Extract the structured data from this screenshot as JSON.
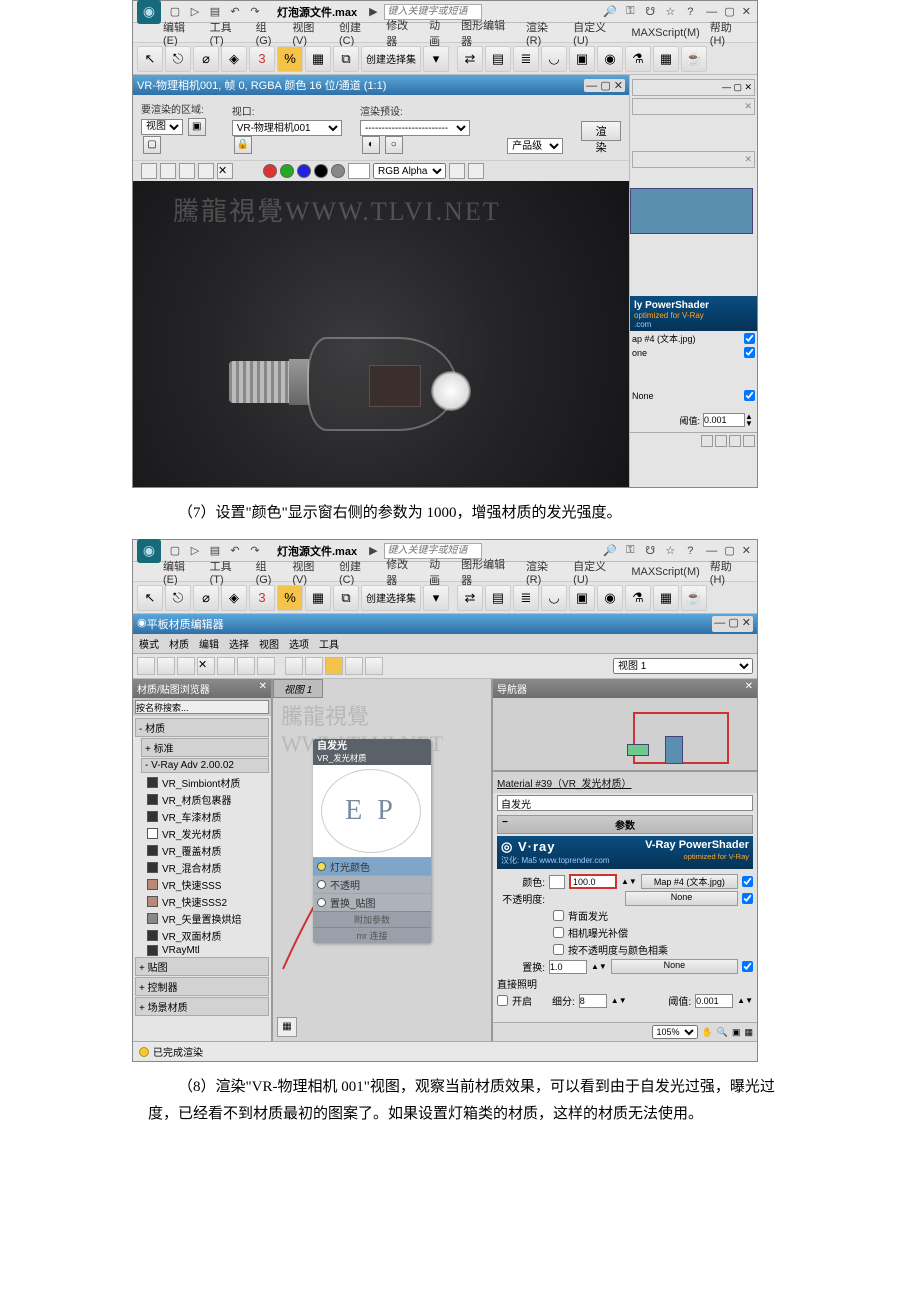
{
  "filename": "灯泡源文件.max",
  "search_placeholder": "键入关键字或短语",
  "menus": [
    "编辑(E)",
    "工具(T)",
    "组(G)",
    "视图(V)",
    "创建(C)",
    "修改器",
    "动画",
    "图形编辑器",
    "渲染(R)",
    "自定义(U)",
    "MAXScript(M)",
    "帮助(H)"
  ],
  "toolbar_label": "创建选择集",
  "frame": {
    "title": "VR-物理相机001, 帧 0, RGBA 颜色 16 位/通道 (1:1)",
    "area_lbl": "要渲染的区域:",
    "area_val": "视图",
    "viewport_lbl": "视口:",
    "viewport_val": "VR-物理相机001",
    "preset_lbl": "渲染预设:",
    "preset_val": "-------------------------",
    "prod_val": "产品级",
    "render_btn": "渲染",
    "channel": "RGB Alpha"
  },
  "watermark": "騰龍視覺WWW.TLVI.NET",
  "right": {
    "ps_title": "ly PowerShader",
    "ps_sub": "optimized for V-Ray",
    "map1": "ap #4 (文本.jpg)",
    "map2": "one",
    "map3": "None",
    "thresh_lbl": "阈值:",
    "thresh_val": "0.001"
  },
  "para7": "（7）设置\"颜色\"显示窗右侧的参数为 1000，增强材质的发光强度。",
  "slate": {
    "title": "平板材质编辑器",
    "menu": [
      "模式",
      "材质",
      "编辑",
      "选择",
      "视图",
      "选项",
      "工具"
    ],
    "viewsel": "视图 1",
    "browser_hdr": "材质/贴图浏览器",
    "search": "按名称搜索...",
    "g_mat": "- 材质",
    "g_std": "+ 标准",
    "g_vray": "- V-Ray Adv 2.00.02",
    "mats": [
      "VR_Simbiont材质",
      "VR_材质包裹器",
      "VR_车漆材质",
      "VR_发光材质",
      "VR_覆盖材质",
      "VR_混合材质",
      "VR_快速SSS",
      "VR_快速SSS2",
      "VR_矢量置换烘焙",
      "VR_双面材质",
      "VRayMtl"
    ],
    "g_map": "+ 贴图",
    "g_ctrl": "+ 控制器",
    "g_scene": "+ 场景材质",
    "nodeview_tab": "视图 1",
    "node_title1": "自发光",
    "node_title2": "VR_发光材质",
    "slot1": "灯光颜色",
    "slot2": "不透明",
    "slot3": "置换_贴图",
    "slot_add": "附加参数",
    "slot_mr": "mr 连接",
    "navi_hdr": "导航器",
    "matname": "Material #39（VR_发光材质）",
    "self_illum": "自发光",
    "roll": "参数",
    "vray_logo": "V·ray",
    "ps_big": "V-Ray PowerShader",
    "ps_small": "optimized for V-Ray",
    "hanhua": "汉化: Ma5 www.toprender.com",
    "color_lbl": "颜色:",
    "color_val": "100.0",
    "color_map": "Map #4 (文本.jpg)",
    "opacity_lbl": "不透明度:",
    "opacity_map": "None",
    "cb1": "背面发光",
    "cb2": "相机曝光补偿",
    "cb3": "按不透明度与颜色相乘",
    "disp_lbl": "置换:",
    "disp_val": "1.0",
    "disp_map": "None",
    "direct_lbl": "直接照明",
    "on_lbl": "开启",
    "subdiv_lbl": "细分:",
    "subdiv_val": "8",
    "thresh_lbl": "阈值:",
    "thresh_val": "0.001",
    "zoom": "105%"
  },
  "status": "已完成渲染",
  "para8": "（8）渲染\"VR-物理相机 001\"视图，观察当前材质效果，可以看到由于自发光过强，曝光过度，已经看不到材质最初的图案了。如果设置灯箱类的材质，这样的材质无法使用。"
}
